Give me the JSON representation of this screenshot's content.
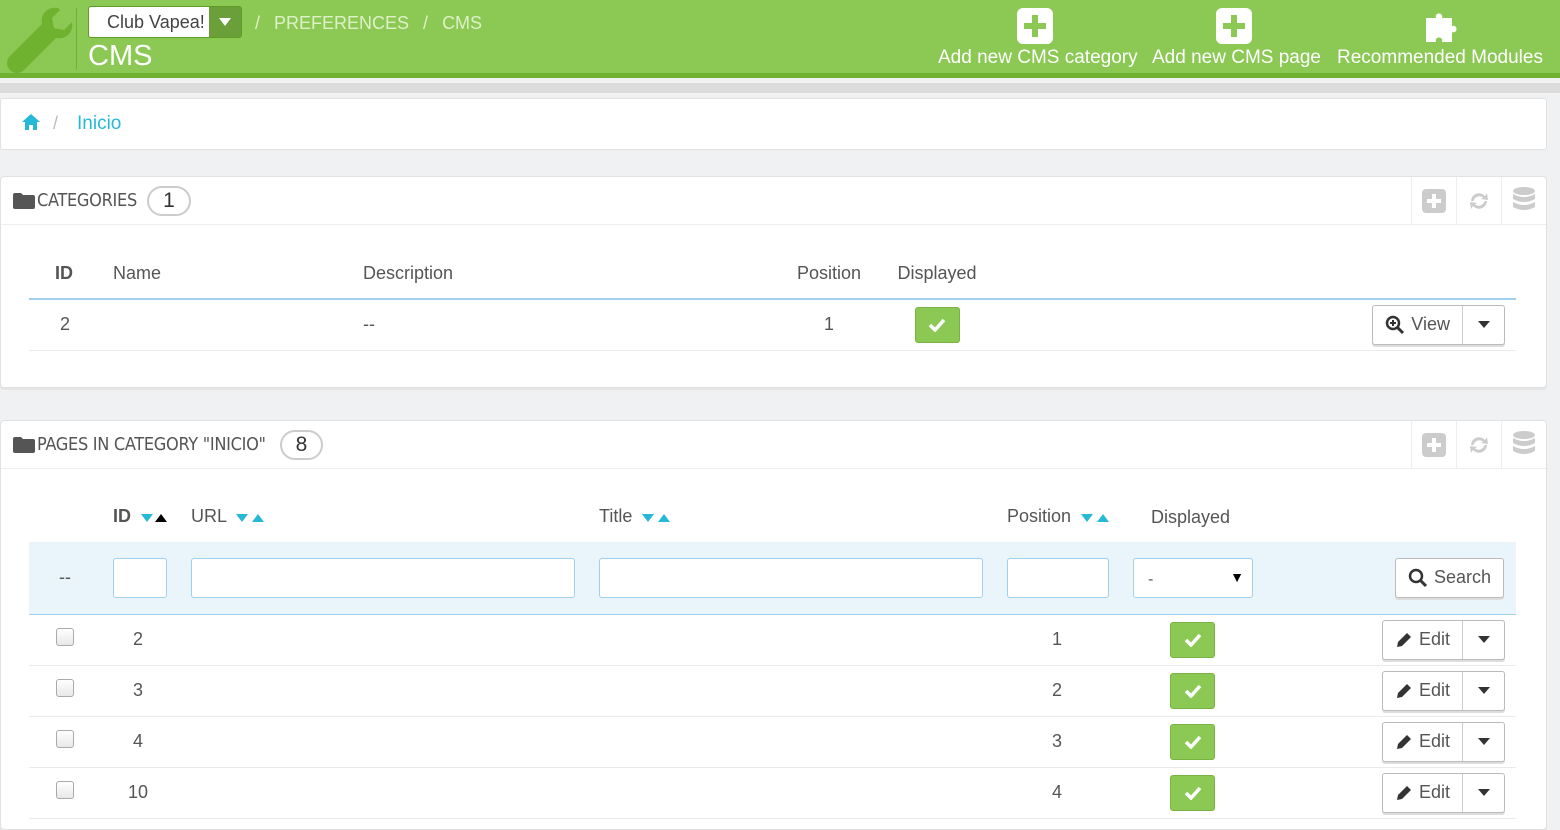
{
  "header": {
    "shop_name": "Club Vapea!",
    "breadcrumb": [
      "PREFERENCES",
      "CMS"
    ],
    "title": "CMS",
    "toolbar": [
      {
        "label": "Add new CMS category",
        "icon": "plus-square-icon"
      },
      {
        "label": "Add new CMS page",
        "icon": "plus-square-icon"
      },
      {
        "label": "Recommended Modules",
        "icon": "puzzle-icon"
      }
    ]
  },
  "breadcrumb_panel": {
    "separator": "/",
    "current": "Inicio"
  },
  "categories": {
    "title": "CATEGORIES",
    "count": "1",
    "columns": {
      "id": "ID",
      "name": "Name",
      "description": "Description",
      "position": "Position",
      "displayed": "Displayed"
    },
    "rows": [
      {
        "id": "2",
        "name": "",
        "description": "--",
        "position": "1",
        "displayed": true,
        "action": "View"
      }
    ]
  },
  "pages": {
    "title": "PAGES IN CATEGORY \"INICIO\"",
    "count": "8",
    "columns": {
      "id": "ID",
      "url": "URL",
      "title": "Title",
      "position": "Position",
      "displayed": "Displayed"
    },
    "filter": {
      "bulk": "--",
      "displayed_value": "-",
      "search_label": "Search"
    },
    "rows": [
      {
        "id": "2",
        "url": "",
        "title": "",
        "position": "1",
        "displayed": true,
        "action": "Edit"
      },
      {
        "id": "3",
        "url": "",
        "title": "",
        "position": "2",
        "displayed": true,
        "action": "Edit"
      },
      {
        "id": "4",
        "url": "",
        "title": "",
        "position": "3",
        "displayed": true,
        "action": "Edit"
      },
      {
        "id": "10",
        "url": "",
        "title": "",
        "position": "4",
        "displayed": true,
        "action": "Edit"
      }
    ]
  },
  "colors": {
    "header_green": "#8bc954",
    "accent_blue": "#25b9d7"
  }
}
